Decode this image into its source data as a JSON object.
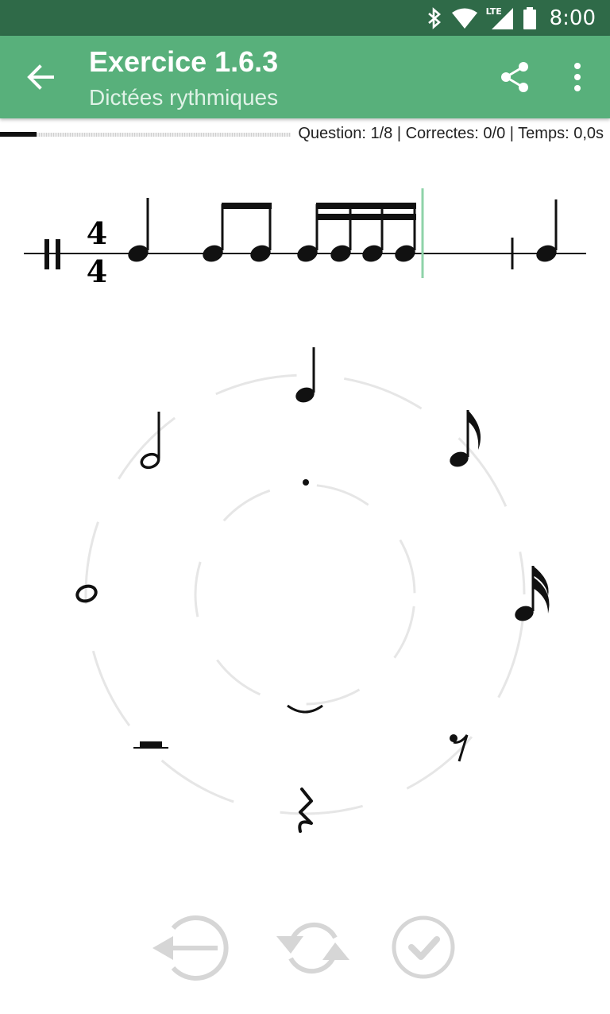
{
  "status": {
    "time": "8:00",
    "network": "LTE"
  },
  "appbar": {
    "title": "Exercice 1.6.3",
    "subtitle": "Dictées rythmiques",
    "back_icon": "arrow-left-icon",
    "share_icon": "share-icon",
    "more_icon": "more-vertical-icon"
  },
  "progress": {
    "fraction": 0.125
  },
  "stats": "Question: 1/8 | Correctes: 0/0 | Temps: 0,0s",
  "staff": {
    "time_signature": {
      "top": "4",
      "bottom": "4"
    },
    "cursor_color": "#8fd3a9"
  },
  "palette": {
    "notes": [
      "quarter-note",
      "eighth-note",
      "sixteenth-note",
      "eighth-rest",
      "quarter-rest",
      "half-rest",
      "whole-note",
      "half-note"
    ],
    "modifiers": [
      "dot",
      "tie"
    ]
  },
  "controls": [
    "undo-icon",
    "refresh-icon",
    "check-icon"
  ],
  "colors": {
    "appbar": "#58b07b",
    "statusbar": "#2f6a48",
    "ring": "#e6e6e6",
    "button": "#d6d6d6"
  }
}
